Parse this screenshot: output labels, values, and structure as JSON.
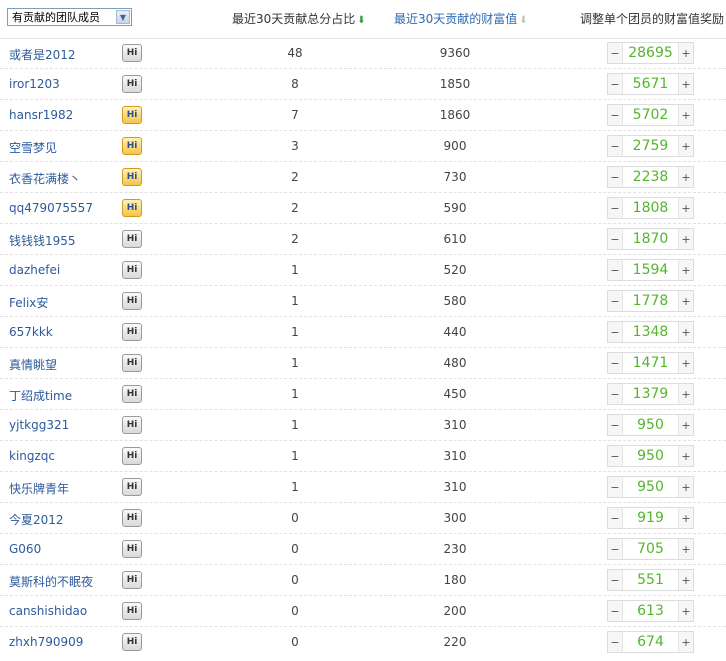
{
  "header": {
    "filter_label": "有贡献的团队成员",
    "share_label": "最近30天贡献总分占比",
    "share_sort": "⬇",
    "value_label": "最近30天贡献的财富值",
    "value_sort": "⬇",
    "reward_label": "调整单个团员的财富值奖励"
  },
  "stepper": {
    "minus": "−",
    "plus": "+"
  },
  "hi_label": "Hi",
  "members": [
    {
      "name": "或者是2012",
      "hi_on": false,
      "share": "48",
      "value": "9360",
      "reward": "28695"
    },
    {
      "name": "iror1203",
      "hi_on": false,
      "share": "8",
      "value": "1850",
      "reward": "5671"
    },
    {
      "name": "hansr1982",
      "hi_on": true,
      "share": "7",
      "value": "1860",
      "reward": "5702"
    },
    {
      "name": "空雪梦见",
      "hi_on": true,
      "share": "3",
      "value": "900",
      "reward": "2759"
    },
    {
      "name": "衣香花满楼丶",
      "hi_on": true,
      "share": "2",
      "value": "730",
      "reward": "2238"
    },
    {
      "name": "qq479075557",
      "hi_on": true,
      "share": "2",
      "value": "590",
      "reward": "1808"
    },
    {
      "name": "钱钱钱1955",
      "hi_on": false,
      "share": "2",
      "value": "610",
      "reward": "1870"
    },
    {
      "name": "dazhefei",
      "hi_on": false,
      "share": "1",
      "value": "520",
      "reward": "1594"
    },
    {
      "name": "Felix安",
      "hi_on": false,
      "share": "1",
      "value": "580",
      "reward": "1778"
    },
    {
      "name": "657kkk",
      "hi_on": false,
      "share": "1",
      "value": "440",
      "reward": "1348"
    },
    {
      "name": "真情眺望",
      "hi_on": false,
      "share": "1",
      "value": "480",
      "reward": "1471"
    },
    {
      "name": "丁绍成time",
      "hi_on": false,
      "share": "1",
      "value": "450",
      "reward": "1379"
    },
    {
      "name": "yjtkgg321",
      "hi_on": false,
      "share": "1",
      "value": "310",
      "reward": "950"
    },
    {
      "name": "kingzqc",
      "hi_on": false,
      "share": "1",
      "value": "310",
      "reward": "950"
    },
    {
      "name": "快乐牌青年",
      "hi_on": false,
      "share": "1",
      "value": "310",
      "reward": "950"
    },
    {
      "name": "今夏2012",
      "hi_on": false,
      "share": "0",
      "value": "300",
      "reward": "919"
    },
    {
      "name": "G060",
      "hi_on": false,
      "share": "0",
      "value": "230",
      "reward": "705"
    },
    {
      "name": "莫斯科的不眠夜",
      "hi_on": false,
      "share": "0",
      "value": "180",
      "reward": "551"
    },
    {
      "name": "canshishidao",
      "hi_on": false,
      "share": "0",
      "value": "200",
      "reward": "613"
    },
    {
      "name": "zhxh790909",
      "hi_on": false,
      "share": "0",
      "value": "220",
      "reward": "674"
    }
  ]
}
